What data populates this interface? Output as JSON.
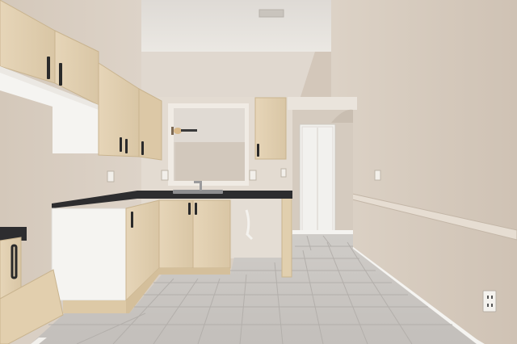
{
  "scene": {
    "description_hidden": "",
    "colors": {
      "wall": "#d8cdc1",
      "wall_right": "#d6cabd",
      "ceiling": "#e6e2dc",
      "floor": "#c9c6c2",
      "grout": "#b5b1ad",
      "cabinet": "#e2d0b2",
      "cabinet_shadow": "#cdb894",
      "countertop": "#2d2d2f",
      "white_panel": "#f4f3f1",
      "door": "#f2f1ee",
      "baseboard": "#f5f4f1",
      "handle": "#2a2a2a"
    },
    "icons": [
      "ceiling-fan-icon",
      "outlet-icon",
      "light-switch-icon",
      "sink-faucet-icon"
    ]
  }
}
